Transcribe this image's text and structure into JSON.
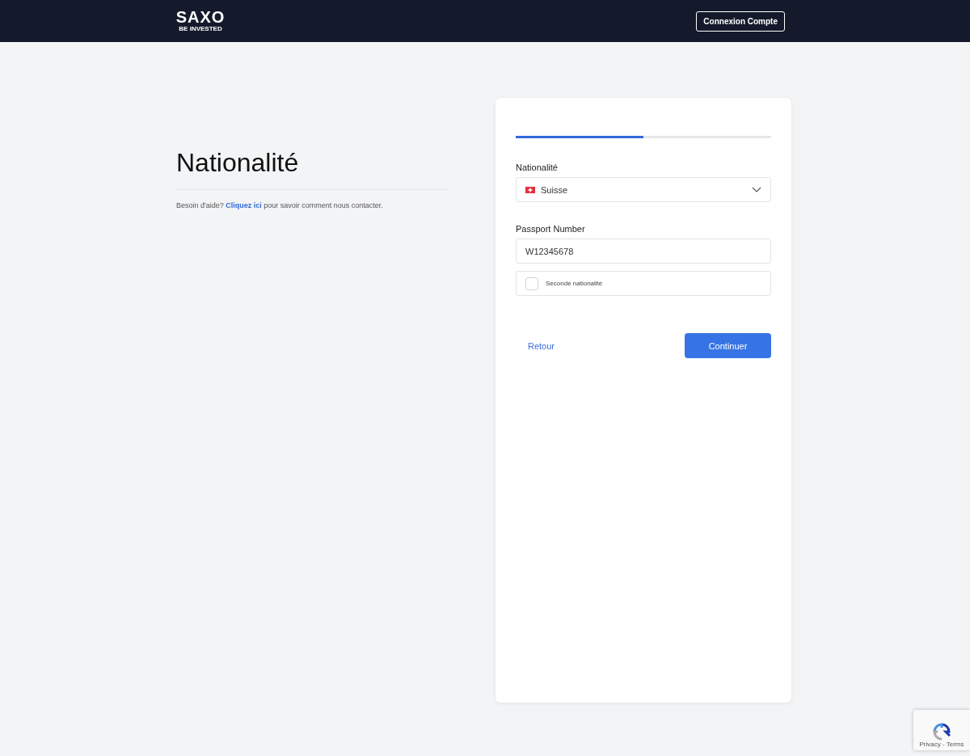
{
  "header": {
    "logo": "SAXO",
    "logo_tagline": "BE INVESTED",
    "login_button": "Connexion Compte"
  },
  "intro": {
    "title": "Nationalité",
    "help": {
      "before": "Besoin d'aide? ",
      "link": "Cliquez ici",
      "after": " pour savoir comment nous contacter."
    }
  },
  "form": {
    "progress": {
      "level": 0.5
    },
    "fields": [
      {
        "kind": "select",
        "label": "Nationalité",
        "value": "Suisse"
      },
      {
        "kind": "text",
        "label": "Passport Number",
        "value": "W12345678"
      },
      {
        "kind": "checkbox",
        "label": "Seconde nationalité",
        "checked": false
      }
    ],
    "back_button": "Retour",
    "continue_button": "Continuer"
  },
  "recaptcha": {
    "text": "Privacy - Terms"
  }
}
